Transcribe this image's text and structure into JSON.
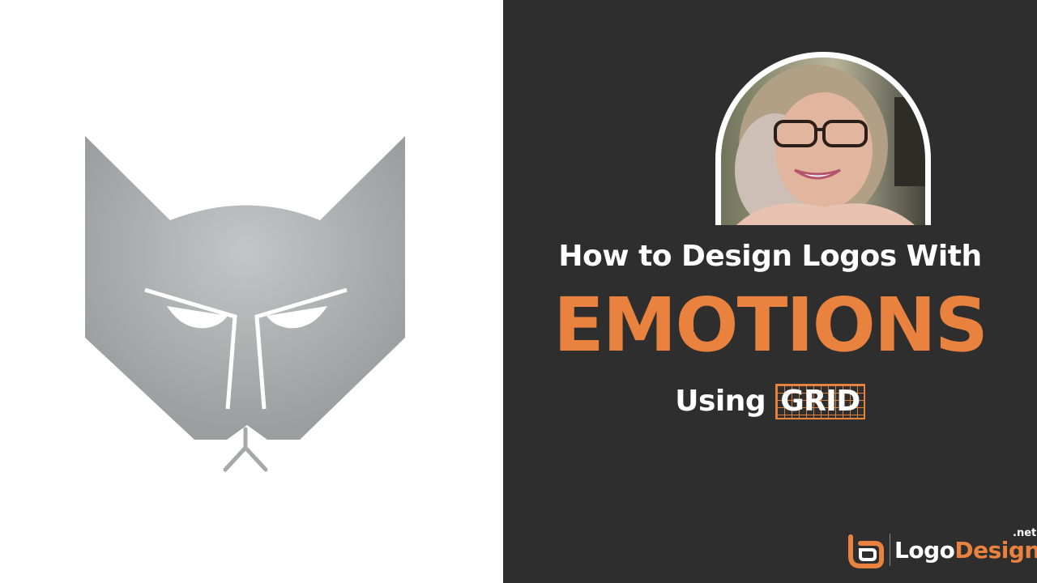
{
  "title": {
    "line1": "How to Design Logos With",
    "line2_parts": [
      "EM",
      "O",
      "TI",
      "O",
      "NS"
    ],
    "line3_prefix": "Using",
    "line3_highlight": "GRID"
  },
  "brand": {
    "logo_word": "Logo",
    "design_word": "Design",
    "suffix": ".net"
  },
  "colors": {
    "background_right": "#2e2e2e",
    "background_left": "#ffffff",
    "accent": "#e8823e",
    "logo_gray": "#a7a8aa",
    "text": "#ffffff"
  },
  "icons": {
    "wolf": "wolf-logo-icon",
    "smile": "smile-face-icon",
    "frown": "frown-face-icon",
    "brand_mark": "logodesign-mark-icon"
  }
}
